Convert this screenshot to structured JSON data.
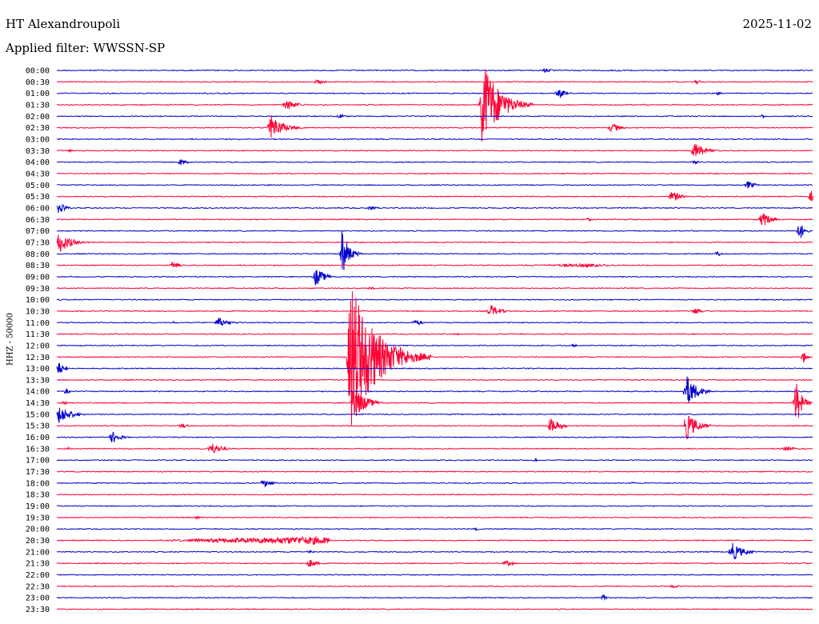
{
  "header": {
    "station": "HT Alexandroupoli",
    "date": "2025-11-02",
    "filter": "Applied filter: WWSSN-SP"
  },
  "chart_data": {
    "type": "line",
    "title": "HT Alexandroupoli",
    "ylabel": "HHZ - 50000",
    "trace_colors": [
      "#0000cc",
      "#ff0033"
    ],
    "rows": [
      {
        "label": "00:00",
        "bursts": [
          {
            "t": 0.64,
            "a": 3,
            "d": 0.03,
            "k": 0.2
          },
          {
            "t": 0.72,
            "a": 1.5,
            "d": 0.04,
            "k": 0.5
          }
        ]
      },
      {
        "label": "00:30",
        "bursts": [
          {
            "t": 0.34,
            "a": 3,
            "d": 0.035,
            "k": 0.15
          },
          {
            "t": 0.84,
            "a": 2.5,
            "d": 0.03,
            "k": 0.2
          }
        ]
      },
      {
        "label": "01:00",
        "bursts": [
          {
            "t": 0.66,
            "a": 5,
            "d": 0.03,
            "k": 0.2
          },
          {
            "t": 0.87,
            "a": 2.5,
            "d": 0.02,
            "k": 0.2
          }
        ]
      },
      {
        "label": "01:30",
        "bursts": [
          {
            "t": 0.56,
            "a": 60,
            "d": 0.07,
            "k": 0.04
          },
          {
            "t": 0.3,
            "a": 6,
            "d": 0.04,
            "k": 0.15
          }
        ]
      },
      {
        "label": "02:00",
        "bursts": [
          {
            "t": 0.37,
            "a": 2.5,
            "d": 0.03,
            "k": 0.15
          },
          {
            "t": 0.93,
            "a": 2,
            "d": 0.02,
            "k": 0.2
          }
        ]
      },
      {
        "label": "02:30",
        "bursts": [
          {
            "t": 0.28,
            "a": 16,
            "d": 0.055,
            "k": 0.06
          },
          {
            "t": 0.73,
            "a": 6,
            "d": 0.035,
            "k": 0.15
          }
        ]
      },
      {
        "label": "03:00",
        "bursts": []
      },
      {
        "label": "03:30",
        "bursts": [
          {
            "t": 0.84,
            "a": 10,
            "d": 0.045,
            "k": 0.1
          },
          {
            "t": 0.01,
            "a": 2,
            "d": 0.02,
            "k": 0.3
          }
        ]
      },
      {
        "label": "04:00",
        "bursts": [
          {
            "t": 0.16,
            "a": 4,
            "d": 0.03,
            "k": 0.15
          },
          {
            "t": 0.84,
            "a": 3,
            "d": 0.02,
            "k": 0.2
          }
        ]
      },
      {
        "label": "04:30",
        "bursts": []
      },
      {
        "label": "05:00",
        "bursts": [
          {
            "t": 0.91,
            "a": 5,
            "d": 0.03,
            "k": 0.15
          }
        ]
      },
      {
        "label": "05:30",
        "bursts": [
          {
            "t": 0.81,
            "a": 7,
            "d": 0.04,
            "k": 0.1
          },
          {
            "t": 0.995,
            "a": 8,
            "d": 0.01,
            "k": 0.3
          }
        ]
      },
      {
        "label": "06:00",
        "bursts": [
          {
            "t": 0.0,
            "a": 8,
            "d": 0.03,
            "k": 0.05
          },
          {
            "t": 0.41,
            "a": 3,
            "d": 0.03,
            "k": 0.2
          }
        ]
      },
      {
        "label": "06:30",
        "bursts": [
          {
            "t": 0.93,
            "a": 10,
            "d": 0.035,
            "k": 0.1
          },
          {
            "t": 0.7,
            "a": 2.5,
            "d": 0.02,
            "k": 0.2
          }
        ]
      },
      {
        "label": "07:00",
        "bursts": [
          {
            "t": 0.98,
            "a": 14,
            "d": 0.02,
            "k": 0.1
          }
        ]
      },
      {
        "label": "07:30",
        "bursts": [
          {
            "t": 0.0,
            "a": 14,
            "d": 0.05,
            "k": 0.05
          }
        ]
      },
      {
        "label": "08:00",
        "bursts": [
          {
            "t": 0.375,
            "a": 30,
            "d": 0.03,
            "k": 0.06
          },
          {
            "t": 0.87,
            "a": 3,
            "d": 0.02,
            "k": 0.2
          }
        ]
      },
      {
        "label": "08:30",
        "bursts": [
          {
            "t": 0.15,
            "a": 5,
            "d": 0.03,
            "k": 0.1
          },
          {
            "t": 0.61,
            "a": 2,
            "d": 0.12,
            "k": 0.8
          }
        ]
      },
      {
        "label": "09:00",
        "bursts": [
          {
            "t": 0.34,
            "a": 12,
            "d": 0.04,
            "k": 0.05
          }
        ]
      },
      {
        "label": "09:30",
        "bursts": [
          {
            "t": 0.41,
            "a": 2,
            "d": 0.03,
            "k": 0.2
          }
        ]
      },
      {
        "label": "10:00",
        "bursts": []
      },
      {
        "label": "10:30",
        "bursts": [
          {
            "t": 0.57,
            "a": 8,
            "d": 0.04,
            "k": 0.1
          },
          {
            "t": 0.84,
            "a": 4,
            "d": 0.03,
            "k": 0.2
          }
        ]
      },
      {
        "label": "11:00",
        "bursts": [
          {
            "t": 0.21,
            "a": 7,
            "d": 0.04,
            "k": 0.1
          },
          {
            "t": 0.47,
            "a": 4,
            "d": 0.03,
            "k": 0.2
          },
          {
            "t": 0.15,
            "a": 2,
            "d": 0.02,
            "k": 0.2
          }
        ]
      },
      {
        "label": "11:30",
        "bursts": [
          {
            "t": 0.52,
            "a": 1.5,
            "d": 0.03,
            "k": 0.3
          }
        ]
      },
      {
        "label": "12:00",
        "bursts": [
          {
            "t": 0.68,
            "a": 2.5,
            "d": 0.02,
            "k": 0.2
          }
        ]
      },
      {
        "label": "12:30",
        "bursts": [
          {
            "t": 0.385,
            "a": 100,
            "d": 0.11,
            "k": 0.03
          },
          {
            "t": 0.985,
            "a": 8,
            "d": 0.015,
            "k": 0.2
          }
        ]
      },
      {
        "label": "13:00",
        "bursts": [
          {
            "t": 0.0,
            "a": 10,
            "d": 0.025,
            "k": 0.05
          }
        ]
      },
      {
        "label": "13:30",
        "bursts": []
      },
      {
        "label": "14:00",
        "bursts": [
          {
            "t": 0.83,
            "a": 20,
            "d": 0.045,
            "k": 0.08
          },
          {
            "t": 0.01,
            "a": 4,
            "d": 0.02,
            "k": 0.1
          }
        ]
      },
      {
        "label": "14:30",
        "bursts": [
          {
            "t": 0.39,
            "a": 22,
            "d": 0.05,
            "k": 0.05
          },
          {
            "t": 0.975,
            "a": 30,
            "d": 0.025,
            "k": 0.1
          },
          {
            "t": 0.005,
            "a": 3,
            "d": 0.02,
            "k": 0.2
          }
        ]
      },
      {
        "label": "15:00",
        "bursts": [
          {
            "t": 0.0,
            "a": 12,
            "d": 0.05,
            "k": 0.05
          }
        ]
      },
      {
        "label": "15:30",
        "bursts": [
          {
            "t": 0.65,
            "a": 10,
            "d": 0.04,
            "k": 0.08
          },
          {
            "t": 0.83,
            "a": 18,
            "d": 0.045,
            "k": 0.08
          },
          {
            "t": 0.16,
            "a": 3,
            "d": 0.03,
            "k": 0.2
          }
        ]
      },
      {
        "label": "16:00",
        "bursts": [
          {
            "t": 0.07,
            "a": 8,
            "d": 0.035,
            "k": 0.08
          }
        ]
      },
      {
        "label": "16:30",
        "bursts": [
          {
            "t": 0.2,
            "a": 8,
            "d": 0.045,
            "k": 0.1
          },
          {
            "t": 0.96,
            "a": 4,
            "d": 0.03,
            "k": 0.2
          },
          {
            "t": 0.01,
            "a": 2,
            "d": 0.02,
            "k": 0.2
          }
        ]
      },
      {
        "label": "17:00",
        "bursts": [
          {
            "t": 0.63,
            "a": 2,
            "d": 0.02,
            "k": 0.2
          }
        ]
      },
      {
        "label": "17:30",
        "bursts": []
      },
      {
        "label": "18:00",
        "bursts": [
          {
            "t": 0.27,
            "a": 5,
            "d": 0.04,
            "k": 0.1
          },
          {
            "t": 0.76,
            "a": 2,
            "d": 0.01,
            "k": 0.2
          }
        ]
      },
      {
        "label": "18:30",
        "bursts": []
      },
      {
        "label": "19:00",
        "bursts": []
      },
      {
        "label": "19:30",
        "bursts": [
          {
            "t": 0.18,
            "a": 2,
            "d": 0.03,
            "k": 0.2
          }
        ]
      },
      {
        "label": "20:00",
        "bursts": [
          {
            "t": 0.55,
            "a": 2,
            "d": 0.02,
            "k": 0.2
          }
        ]
      },
      {
        "label": "20:30",
        "bursts": [
          {
            "t": 0.18,
            "a": 5,
            "d": 0.18,
            "k": 0.9
          }
        ]
      },
      {
        "label": "21:00",
        "bursts": [
          {
            "t": 0.89,
            "a": 12,
            "d": 0.045,
            "k": 0.08
          },
          {
            "t": 0.33,
            "a": 2,
            "d": 0.02,
            "k": 0.2
          }
        ]
      },
      {
        "label": "21:30",
        "bursts": [
          {
            "t": 0.33,
            "a": 5,
            "d": 0.04,
            "k": 0.1
          },
          {
            "t": 0.59,
            "a": 4,
            "d": 0.03,
            "k": 0.15
          }
        ]
      },
      {
        "label": "22:00",
        "bursts": []
      },
      {
        "label": "22:30",
        "bursts": [
          {
            "t": 0.81,
            "a": 2.5,
            "d": 0.03,
            "k": 0.2
          }
        ]
      },
      {
        "label": "23:00",
        "bursts": [
          {
            "t": 0.72,
            "a": 5,
            "d": 0.02,
            "k": 0.1
          },
          {
            "t": 0.54,
            "a": 1.5,
            "d": 0.02,
            "k": 0.2
          }
        ]
      },
      {
        "label": "23:30",
        "bursts": []
      }
    ]
  }
}
